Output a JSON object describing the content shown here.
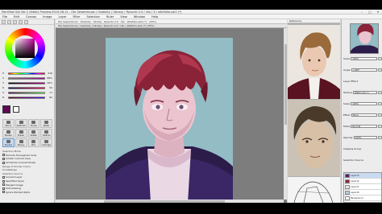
{
  "window": {
    "title": "PaintTool SAI Ver.2 (64bit) Preview.2019.08.12 - Ole Sesemikcow / Osobisty / Obrazy / Rysunki 2.0 / nfp / 3 / stilefolio.sai2 (*)",
    "controls": [
      "–",
      "□",
      "✕"
    ]
  },
  "menu": [
    "File",
    "Edit",
    "Canvas",
    "Image",
    "Layer",
    "Filter",
    "Selection",
    "Ruler",
    "View",
    "Window",
    "Help"
  ],
  "left_panel": {
    "color_sliders": [
      {
        "label": "H",
        "value": "316"
      },
      {
        "label": "S",
        "value": "88%"
      },
      {
        "label": "V",
        "value": "46%"
      },
      {
        "label": "R",
        "value": "94"
      },
      {
        "label": "G",
        "value": "11"
      },
      {
        "label": "B",
        "value": "82"
      }
    ],
    "colors": {
      "primary": "#5e0b52",
      "secondary": "#ffffff"
    },
    "tools": [
      {
        "name": "Pencil",
        "icon": "pencil-icon"
      },
      {
        "name": "AirBrush",
        "icon": "airbrush-icon"
      },
      {
        "name": "Brush",
        "icon": "brush-icon"
      },
      {
        "name": "Water",
        "icon": "water-icon"
      },
      {
        "name": "Marker",
        "icon": "marker-icon"
      },
      {
        "name": "Eraser",
        "icon": "eraser-icon"
      },
      {
        "name": "SelPen",
        "icon": "selection-pen-icon"
      },
      {
        "name": "SelEras",
        "icon": "selection-eraser-icon"
      },
      {
        "name": "Bucket",
        "icon": "bucket-icon"
      },
      {
        "name": "Binary",
        "icon": "binary-icon"
      },
      {
        "name": "Blur",
        "icon": "blur-icon"
      },
      {
        "name": "Smudge",
        "icon": "smudge-icon"
      }
    ],
    "active_tool": "Bucket",
    "options": [
      {
        "text": "Selection Mode",
        "type": "header"
      },
      {
        "text": "Exclude Transparent Area",
        "type": "check"
      },
      {
        "text": "Similar Colored Area",
        "type": "check"
      },
      {
        "text": "All Similar Colored Pixels",
        "type": "check"
      },
      {
        "text": "Range of Similar Colors",
        "type": "header"
      },
      {
        "text": "SomeRange",
        "type": "header"
      },
      {
        "text": "Selection Source",
        "type": "header"
      },
      {
        "text": "Current Layer",
        "type": "check"
      },
      {
        "text": "Specified Layer",
        "type": "check"
      },
      {
        "text": "Merged Image",
        "type": "check"
      },
      {
        "text": "Anti-Aliasing",
        "type": "check"
      },
      {
        "text": "Ignore Painted Parts",
        "type": "check"
      }
    ]
  },
  "canvas": {
    "nav_items": [
      "Ole Sesemikcow",
      "Osobisty",
      "Obrazy",
      "Rysunki 2.0",
      "nfp",
      "stilefolio.sai2 (*)",
      "(25%)"
    ],
    "tab_label": "Ole Sesemikcow / Osobisty / Obrazy / Rysunki 2.0 / nfp / stilefolio.sai2 (*) (25%)"
  },
  "reference": {
    "title": "Reference"
  },
  "right_panel": {
    "rows": [
      {
        "label": "Scale",
        "value": "100%"
      },
      {
        "label": "Angle",
        "value": "+000°"
      },
      {
        "label": "Layer Effect",
        "value": ""
      },
      {
        "label": "Texture",
        "value": "Watercolor 1"
      },
      {
        "label": "Scale",
        "value": "100%"
      },
      {
        "label": "Effect",
        "value": "None"
      },
      {
        "label": "Mode",
        "value": "Normal"
      },
      {
        "label": "Opacity",
        "value": "100%"
      },
      {
        "label": "Clipping Group",
        "value": ""
      },
      {
        "label": "Selection Source",
        "value": ""
      }
    ],
    "layers": [
      {
        "name": "Layer13",
        "color": "#5a1b5c",
        "selected": true
      },
      {
        "name": "Layer12",
        "color": "#8a2a3a",
        "selected": false
      },
      {
        "name": "Layer11",
        "color": "#e9e6ef",
        "selected": false
      },
      {
        "name": "Layer10",
        "color": "#b6ced7",
        "selected": false
      },
      {
        "name": "Background",
        "color": "#ffffff",
        "selected": false
      }
    ]
  }
}
